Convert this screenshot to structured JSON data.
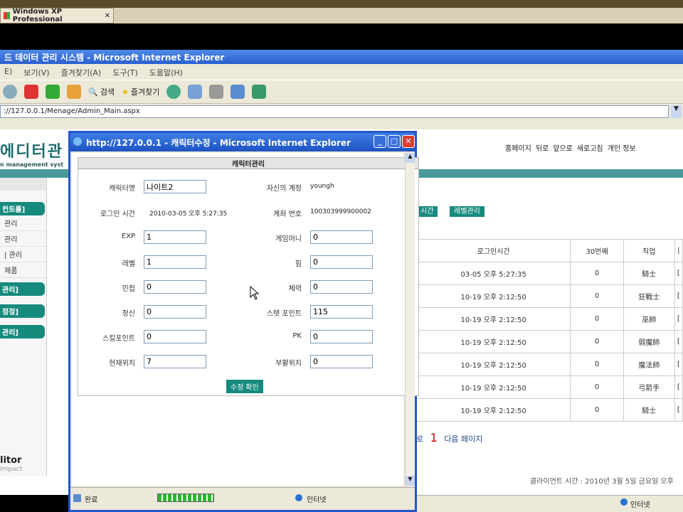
{
  "vm": {
    "tab_title": "Windows XP Professional"
  },
  "ie": {
    "title": "드 데이터 관리 시스템 - Microsoft Internet Explorer",
    "menu": [
      "E)",
      "보기(V)",
      "즐겨찾기(A)",
      "도구(T)",
      "도움말(H)"
    ],
    "search_label": "검색",
    "favorites_label": "즐겨찾기",
    "address": "://127.0.0.1/Menage/Admin_Main.aspx"
  },
  "page": {
    "logo": "에디터관",
    "logo_sub": "n management syst",
    "topnav": [
      "홈페이지",
      "뒤로",
      "앞으로",
      "새로고침",
      "개인 정보"
    ],
    "sidebar": {
      "section1": "컨트롤]",
      "items": [
        "관리",
        "관리",
        "| 관리",
        "제품"
      ],
      "section2": "관리]",
      "section3": "정정]",
      "section4": "관리]",
      "footer": "litor",
      "footer_sub": "Impact"
    },
    "tabs": [
      "시간",
      "레벨관리"
    ],
    "grid": {
      "headers": [
        "로그인시간",
        "30번째",
        "직업",
        "|"
      ],
      "rows": [
        [
          "03-05 오후 5:27:35",
          "0",
          "騎士",
          "["
        ],
        [
          "10-19 오후 2:12:50",
          "0",
          "狂戰士",
          "["
        ],
        [
          "10-19 오후 2:12:50",
          "0",
          "巫師",
          "["
        ],
        [
          "10-19 오후 2:12:50",
          "0",
          "弱魔師",
          "["
        ],
        [
          "10-19 오후 2:12:50",
          "0",
          "魔法師",
          "["
        ],
        [
          "10-19 오후 2:12:50",
          "0",
          "弓箭手",
          "["
        ],
        [
          "10-19 오후 2:12:50",
          "0",
          "騎士",
          "["
        ]
      ]
    },
    "pager": {
      "prev": "로",
      "current": "1",
      "next": "다음 페이지"
    },
    "client_time": "클라이언트 시간 : 2010년 3월 5일 금요일 오후",
    "status": "인터넷"
  },
  "popup": {
    "title": "http://127.0.0.1 - 캐릭터수정 - Microsoft Internet Explorer",
    "panel_title": "캐릭터관리",
    "fields": {
      "char_name_label": "캐릭터명",
      "char_name": "나이트2",
      "account_label": "자신의 계정",
      "account": "youngh",
      "login_label": "로그인 시간",
      "login": "2010-03-05 오후 5:27:35",
      "account_no_label": "계좌 번호",
      "account_no": "100303999900002",
      "exp_label": "EXP",
      "exp": "1",
      "money_label": "게임머니",
      "money": "0",
      "level_label": "레벨",
      "level": "1",
      "str_label": "힘",
      "str": "0",
      "agi_label": "민첩",
      "agi": "0",
      "hp_label": "체력",
      "hp": "0",
      "spi_label": "정신",
      "spi": "0",
      "stat_label": "스탯 포인트",
      "stat": "115",
      "skill_label": "스킬포인트",
      "skill": "0",
      "pk_label": "PK",
      "pk": "0",
      "pos_label": "현재위치",
      "pos": "7",
      "respawn_label": "부활위치",
      "respawn": "0"
    },
    "submit": "수정 확인",
    "status": "완료",
    "zone": "인터넷"
  }
}
